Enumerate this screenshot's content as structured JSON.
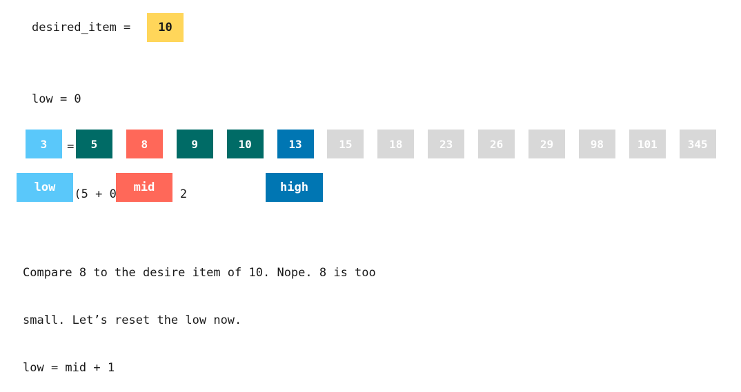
{
  "desired": {
    "label": "desired_item =",
    "value": "10",
    "color": "#ffd65a"
  },
  "vars": {
    "lines": [
      "low = 0",
      "high = 5",
      "mid = (5 + 0) // 2 = 2"
    ]
  },
  "array": {
    "items": [
      {
        "value": "3",
        "color": "#5ac8fa"
      },
      {
        "value": "5",
        "color": "#006b66"
      },
      {
        "value": "8",
        "color": "#ff6859"
      },
      {
        "value": "9",
        "color": "#006b66"
      },
      {
        "value": "10",
        "color": "#006b66"
      },
      {
        "value": "13",
        "color": "#0076b3"
      },
      {
        "value": "15",
        "color": "#d8d8d8"
      },
      {
        "value": "18",
        "color": "#d8d8d8"
      },
      {
        "value": "23",
        "color": "#d8d8d8"
      },
      {
        "value": "26",
        "color": "#d8d8d8"
      },
      {
        "value": "29",
        "color": "#d8d8d8"
      },
      {
        "value": "98",
        "color": "#d8d8d8"
      },
      {
        "value": "101",
        "color": "#d8d8d8"
      },
      {
        "value": "345",
        "color": "#d8d8d8"
      }
    ]
  },
  "pointers": {
    "low": {
      "label": "low",
      "color": "#5ac8fa"
    },
    "mid": {
      "label": "mid",
      "color": "#ff6859"
    },
    "high": {
      "label": "high",
      "color": "#0076b3"
    }
  },
  "explanation": {
    "lines": [
      "Compare 8 to the desire item of 10. Nope. 8 is too",
      "small. Let’s reset the low now.",
      "low = mid + 1"
    ]
  }
}
